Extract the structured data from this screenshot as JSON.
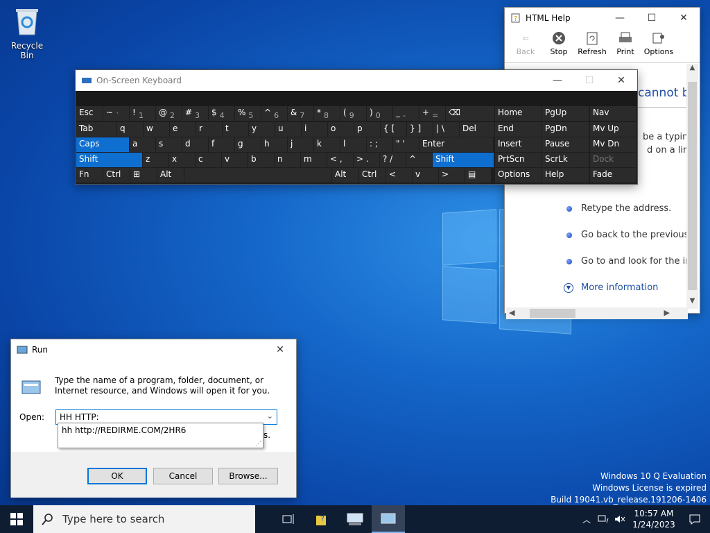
{
  "desktop": {
    "recycle_bin_label": "Recycle Bin",
    "watermark": {
      "line1": "Windows 10 Q Evaluation",
      "line2": "Windows License is expired",
      "line3": "Build 19041.vb_release.191206-1406"
    }
  },
  "taskbar": {
    "search_placeholder": "Type here to search",
    "clock_time": "10:57 AM",
    "clock_date": "1/24/2023"
  },
  "help_window": {
    "title": "HTML Help",
    "toolbar": [
      "Back",
      "Stop",
      "Refresh",
      "Print",
      "Options"
    ],
    "body": {
      "heading_fragment": "cannot b",
      "line1": "be a typing",
      "line2": "d on a link,",
      "bullets": [
        "Retype the address.",
        "Go back to the previous p",
        "Go to  and look for the in"
      ],
      "more_info": "More information"
    }
  },
  "osk": {
    "title": "On-Screen Keyboard",
    "row1": [
      {
        "k": "Esc"
      },
      {
        "k": "~",
        "s": "`"
      },
      {
        "k": "!",
        "s": "1"
      },
      {
        "k": "@",
        "s": "2"
      },
      {
        "k": "#",
        "s": "3"
      },
      {
        "k": "$",
        "s": "4"
      },
      {
        "k": "%",
        "s": "5"
      },
      {
        "k": "^",
        "s": "6"
      },
      {
        "k": "&",
        "s": "7"
      },
      {
        "k": "*",
        "s": "8"
      },
      {
        "k": "(",
        "s": "9"
      },
      {
        "k": ")",
        "s": "0"
      },
      {
        "k": "_",
        "s": "-"
      },
      {
        "k": "+",
        "s": "="
      },
      {
        "k": "⌫"
      }
    ],
    "row2": [
      "Tab",
      "q",
      "w",
      "e",
      "r",
      "t",
      "y",
      "u",
      "i",
      "o",
      "p",
      "{ [",
      "} ]",
      "| \\",
      "Del"
    ],
    "row3": [
      "Caps",
      "a",
      "s",
      "d",
      "f",
      "g",
      "h",
      "j",
      "k",
      "l",
      ": ;",
      "\" '",
      "Enter"
    ],
    "row4": [
      "Shift",
      "z",
      "x",
      "c",
      "v",
      "b",
      "n",
      "m",
      "< ,",
      "> .",
      "? /",
      "^",
      "Shift"
    ],
    "row5": [
      "Fn",
      "Ctrl",
      "⊞",
      "Alt",
      "",
      "Alt",
      "Ctrl",
      "<",
      "v",
      ">",
      "▤"
    ],
    "nav": [
      [
        "Home",
        "PgUp",
        "Nav"
      ],
      [
        "End",
        "PgDn",
        "Mv Up"
      ],
      [
        "Insert",
        "Pause",
        "Mv Dn"
      ],
      [
        "PrtScn",
        "ScrLk",
        "Dock"
      ],
      [
        "Options",
        "Help",
        "Fade"
      ]
    ]
  },
  "run_dialog": {
    "title": "Run",
    "description": "Type the name of a program, folder, document, or Internet resource, and Windows will open it for you.",
    "open_label": "Open:",
    "input_value": "HH HTTP:",
    "autocomplete": "hh http://REDIRME.COM/2HR6",
    "hidden_fragment": "s.",
    "ok": "OK",
    "cancel": "Cancel",
    "browse": "Browse..."
  }
}
